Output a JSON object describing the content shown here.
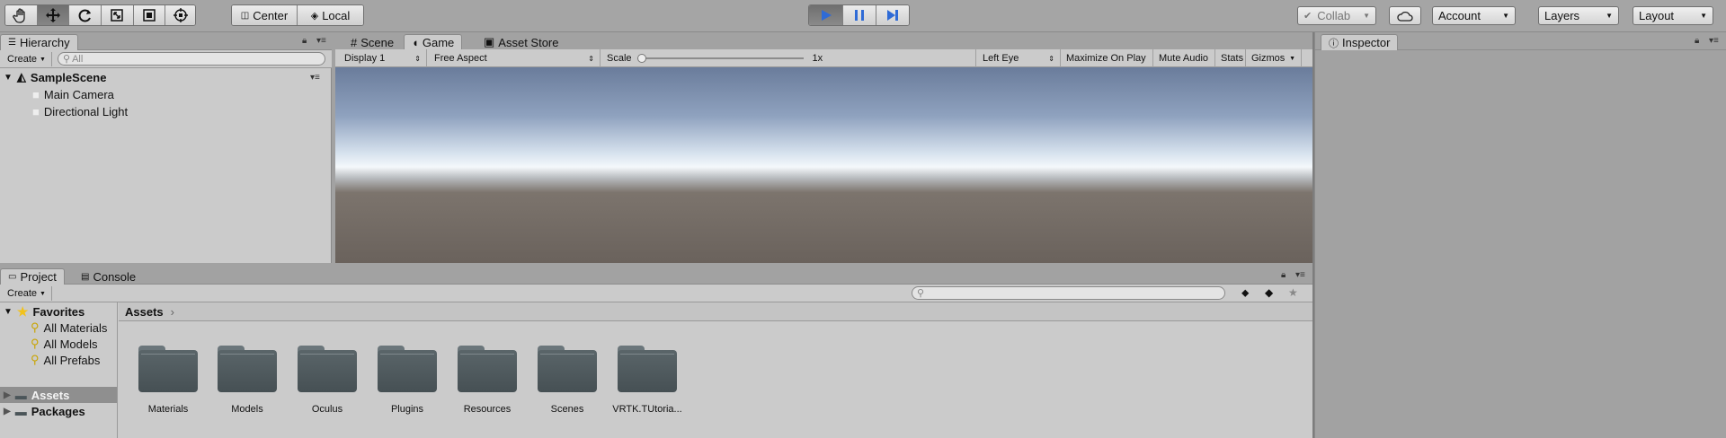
{
  "toolbar": {
    "tools": [
      "hand-tool-icon",
      "move-tool-icon",
      "rotate-tool-icon",
      "scale-tool-icon",
      "rect-tool-icon",
      "transform-tool-icon"
    ],
    "pivot_mode": "Center",
    "pivot_rotation": "Local",
    "play_controls": [
      "play-icon",
      "pause-icon",
      "step-icon"
    ],
    "collab": "Collab",
    "account": "Account",
    "layers": "Layers",
    "layout": "Layout"
  },
  "hierarchy": {
    "tab": "Hierarchy",
    "create": "Create",
    "search_placeholder": "All",
    "scene": "SampleScene",
    "objects": [
      "Main Camera",
      "Directional Light"
    ]
  },
  "center_tabs": {
    "scene": "Scene",
    "game": "Game",
    "asset_store": "Asset Store"
  },
  "game_bar": {
    "display": "Display 1",
    "aspect": "Free Aspect",
    "scale_label": "Scale",
    "scale_value": "1x",
    "eye": "Left Eye",
    "maximize": "Maximize On Play",
    "mute": "Mute Audio",
    "stats": "Stats",
    "gizmos": "Gizmos"
  },
  "inspector": {
    "tab": "Inspector"
  },
  "project": {
    "tab_project": "Project",
    "tab_console": "Console",
    "create": "Create",
    "favorites_label": "Favorites",
    "favorites": [
      "All Materials",
      "All Models",
      "All Prefabs"
    ],
    "roots": [
      "Assets",
      "Packages"
    ],
    "breadcrumb": "Assets",
    "folders": [
      "Materials",
      "Models",
      "Oculus",
      "Plugins",
      "Resources",
      "Scenes",
      "VRTK.TUtoria..."
    ]
  },
  "colors": {
    "panel_bg": "#cbcbcb",
    "toolbar_bg": "#a5a5a5",
    "play_blue": "#2f6bd6",
    "star_yellow": "#f2c21b",
    "folder": "#545f63"
  }
}
